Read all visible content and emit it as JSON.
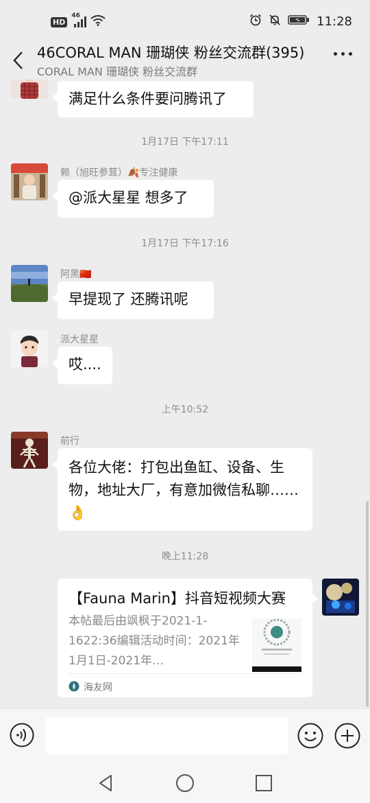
{
  "status_bar": {
    "hd_badge": "HD",
    "network_label": "46",
    "time": "11:28"
  },
  "header": {
    "title": "46CORAL MAN 珊瑚侠 粉丝交流群(395)",
    "subtitle": "CORAL MAN 珊瑚侠 粉丝交流群",
    "back_icon": "chevron-left-icon",
    "more_icon": "more-dots-icon"
  },
  "messages": [
    {
      "type": "text",
      "text": "满足什么条件要问腾讯了"
    },
    {
      "type": "time",
      "text": "1月17日 下午17:11"
    },
    {
      "type": "text",
      "sender": "赖（旭旺参茸）🍂专注健康",
      "text": "@派大星星  想多了"
    },
    {
      "type": "time",
      "text": "1月17日 下午17:16"
    },
    {
      "type": "text",
      "sender": "阿黑🇨🇳",
      "text": "早提现了 还腾讯呢"
    },
    {
      "type": "text",
      "sender": "派大星星",
      "text": "哎...."
    },
    {
      "type": "time",
      "text": "上午10:52"
    },
    {
      "type": "text",
      "sender": "前行",
      "text": "各位大佬：打包出鱼缸、设备、生物，地址大厂，有意加微信私聊……👌"
    },
    {
      "type": "time",
      "text": "晚上11:28"
    },
    {
      "type": "link_card",
      "title": "【Fauna Marin】抖音短视频大赛",
      "desc": "本帖最后由飒枫于2021-1-1622:36编辑活动时间：2021年1月1日-2021年…",
      "source": "海友网"
    }
  ],
  "input_bar": {
    "placeholder": "",
    "voice_icon": "voice-icon",
    "emoji_icon": "emoji-icon",
    "plus_icon": "plus-icon"
  },
  "nav_bar": {
    "back_icon": "nav-back-icon",
    "home_icon": "nav-home-icon",
    "recents_icon": "nav-recents-icon"
  },
  "colors": {
    "background": "#ededed",
    "bubble": "#ffffff",
    "meta_text": "#8c8c8c"
  }
}
